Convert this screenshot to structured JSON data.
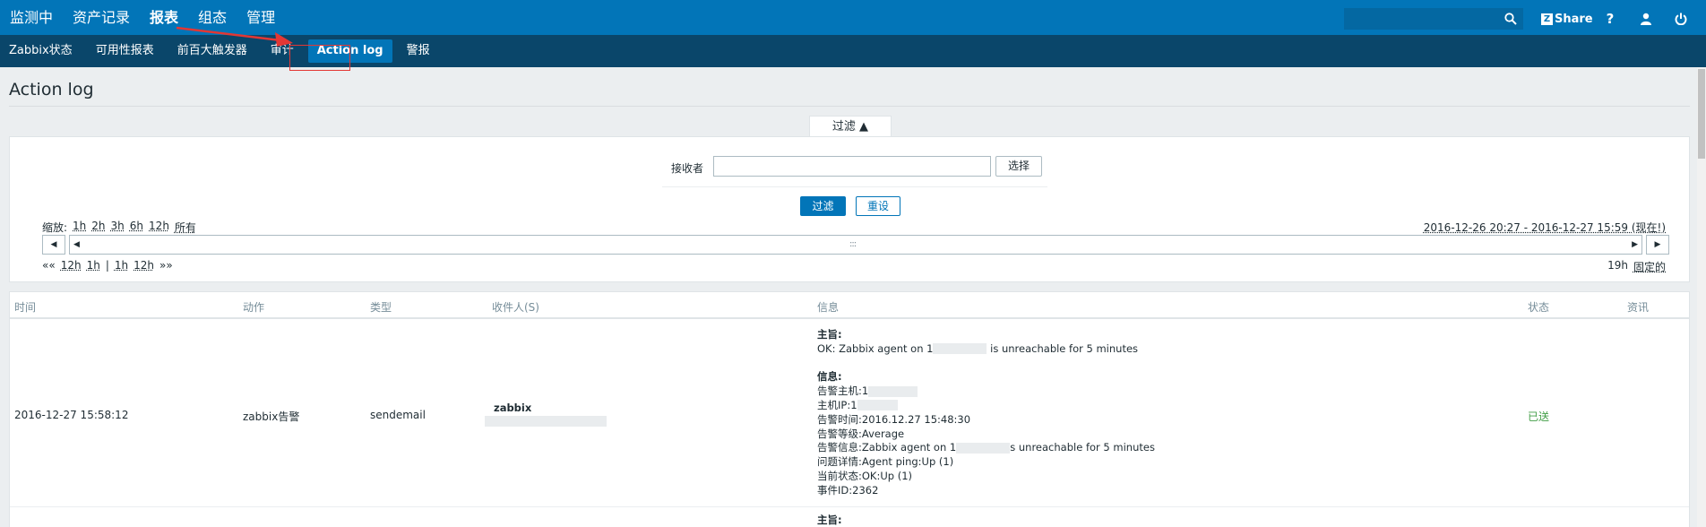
{
  "top_menu": [
    "监测中",
    "资产记录",
    "报表",
    "组态",
    "管理"
  ],
  "top_menu_active": "报表",
  "header": {
    "share_label": "Share",
    "share_icon_letter": "Z",
    "help_label": "?"
  },
  "sub_menu": [
    "Zabbix状态",
    "可用性报表",
    "前百大触发器",
    "审计",
    "Action log",
    "警报"
  ],
  "sub_menu_active": "Action log",
  "page_title": "Action log",
  "filter": {
    "tab_label": "过滤 ▲",
    "recipient_label": "接收者",
    "recipient_value": "",
    "choose_label": "选择",
    "filter_label": "过滤",
    "reset_label": "重设"
  },
  "timeline": {
    "zoom_label": "缩放:",
    "zoom_options": [
      "1h",
      "2h",
      "3h",
      "6h",
      "12h",
      "所有"
    ],
    "range_text": "2016-12-26 20:27 - 2016-12-27 15:59 (现在!)",
    "nav_back_marker": "««",
    "nav_back": [
      "12h",
      "1h"
    ],
    "nav_separator": "|",
    "nav_forward": [
      "1h",
      "12h"
    ],
    "nav_forward_marker": "»»",
    "period_value": "19h",
    "period_fixed": "固定的",
    "grip": ":::"
  },
  "table": {
    "columns": [
      "时间",
      "动作",
      "类型",
      "收件人(S)",
      "信息",
      "状态",
      "资讯"
    ],
    "rows": [
      {
        "time": "2016-12-27 15:58:12",
        "action": "zabbix告警",
        "type": "sendemail",
        "recipient": "zabbix",
        "subject_label": "主旨:",
        "subject_prefix": "OK: Zabbix agent on 1",
        "subject_suffix": "is unreachable for 5 minutes",
        "message_label": "信息:",
        "lines": [
          {
            "k": "告警主机:",
            "v": "1"
          },
          {
            "k": "主机IP:",
            "v": "1"
          },
          {
            "k": "告警时间:",
            "v": "2016.12.27 15:48:30"
          },
          {
            "k": "告警等级:",
            "v": "Average"
          },
          {
            "k": "告警信息:",
            "v": "Zabbix agent on 1",
            "v2": "s unreachable for 5 minutes"
          },
          {
            "k": "问题详情:",
            "v": "Agent ping:Up (1)"
          },
          {
            "k": "当前状态:",
            "v": "OK:Up (1)"
          },
          {
            "k": "事件ID:",
            "v": "2362"
          }
        ],
        "status": "已送"
      }
    ],
    "next_row_subject_label": "主旨:"
  },
  "colors": {
    "topbar": "#0275b8",
    "subbar": "#0a466a",
    "status_sent": "#429e47",
    "annotation": "#e33734"
  }
}
